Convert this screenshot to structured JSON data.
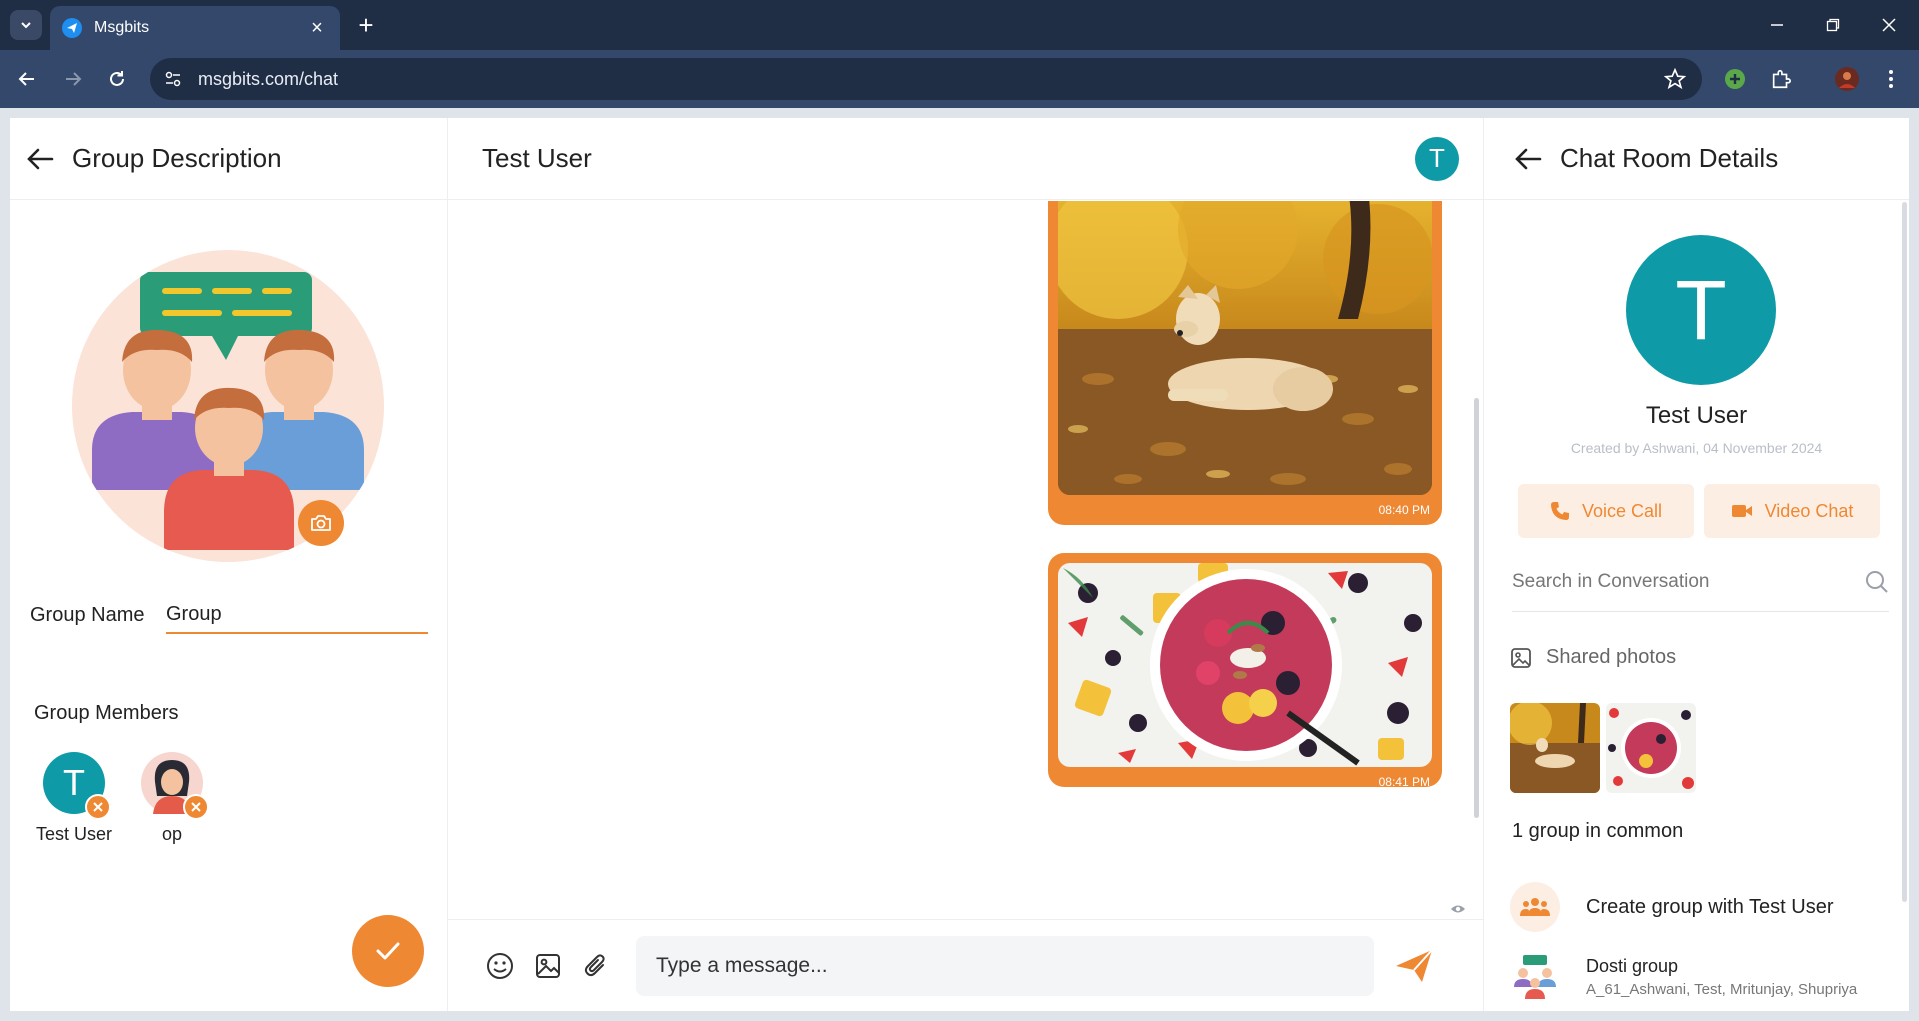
{
  "browser": {
    "tab_title": "Msgbits",
    "url": "msgbits.com/chat"
  },
  "left_panel": {
    "title": "Group Description",
    "group_name_label": "Group Name",
    "group_name_value": "Group",
    "members_title": "Group Members",
    "members": [
      {
        "name": "Test User",
        "initial": "T",
        "color": "#0e9aa7"
      },
      {
        "name": "op",
        "initial": "",
        "color": "#f6d6cf"
      }
    ]
  },
  "center_panel": {
    "title": "Test User",
    "header_initial": "T",
    "messages": [
      {
        "type": "image",
        "subject": "dog-in-autumn-leaves",
        "time": "08:40 PM"
      },
      {
        "type": "image",
        "subject": "fruit-bowl",
        "time": "08:41 PM"
      }
    ],
    "composer_placeholder": "Type a message..."
  },
  "right_panel": {
    "title": "Chat Room Details",
    "profile_initial": "T",
    "profile_name": "Test User",
    "created_by": "Created by Ashwani, 04 November 2024",
    "voice_call_label": "Voice Call",
    "video_chat_label": "Video Chat",
    "search_placeholder": "Search in Conversation",
    "shared_photos_label": "Shared photos",
    "common_groups_label": "1 group in common",
    "create_group_label": "Create group with Test User",
    "groups": [
      {
        "name": "Dosti group",
        "members": "A_61_Ashwani, Test, Mritunjay, Shupriya"
      }
    ]
  },
  "colors": {
    "accent": "#ef8832",
    "teal": "#0e9aa7",
    "browser_dark": "#1f2d45",
    "browser_mid": "#33486a"
  }
}
